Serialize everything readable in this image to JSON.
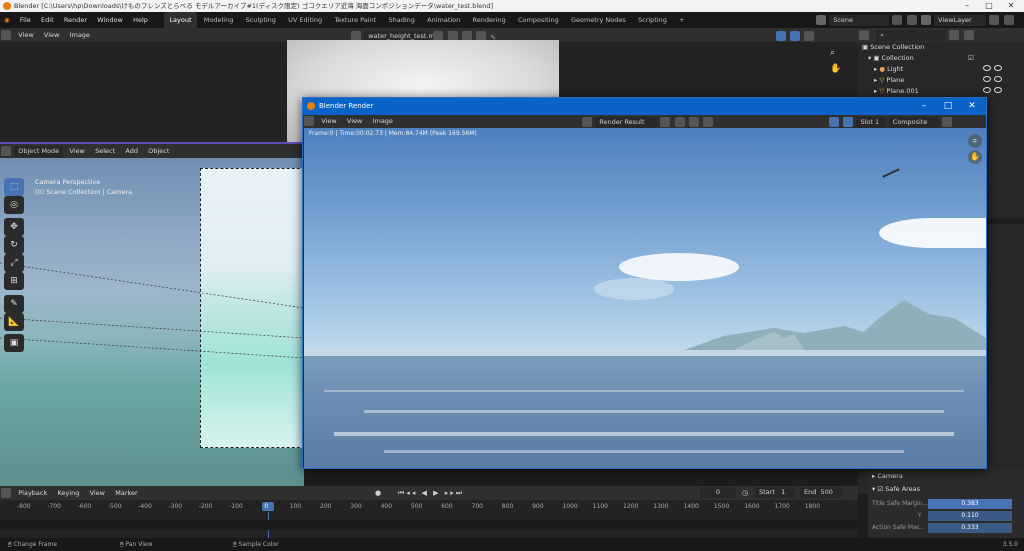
{
  "window": {
    "title": "Blender [C:\\Users\\hp\\Downloads\\けものフレンズとらべる モデルアーカイブ#1(ディスク限定) ゴコクエリア近海 海面コンポジションデータ\\water_test.blend]"
  },
  "menu": [
    "File",
    "Edit",
    "Render",
    "Window",
    "Help"
  ],
  "workspaces": [
    {
      "label": "Layout",
      "active": true
    },
    {
      "label": "Modeling"
    },
    {
      "label": "Sculpting"
    },
    {
      "label": "UV Editing"
    },
    {
      "label": "Texture Paint"
    },
    {
      "label": "Shading"
    },
    {
      "label": "Animation"
    },
    {
      "label": "Rendering"
    },
    {
      "label": "Compositing"
    },
    {
      "label": "Geometry Nodes"
    },
    {
      "label": "Scripting"
    },
    {
      "label": "+"
    }
  ],
  "scene": {
    "name": "Scene",
    "view_layer": "ViewLayer"
  },
  "image_editor": {
    "view": "View",
    "view2": "View",
    "image": "Image",
    "file": "water_height_test.mkv"
  },
  "viewport": {
    "mode": "Object Mode",
    "menus": [
      "View",
      "Select",
      "Add",
      "Object"
    ],
    "overlay_line1": "Camera Perspective",
    "overlay_line2": "(0) Scene Collection | Camera"
  },
  "outliner": {
    "root": "Scene Collection",
    "collection": "Collection",
    "items": [
      "Light",
      "Plane",
      "Plane.001"
    ]
  },
  "render_window": {
    "title": "Blender Render",
    "menus": [
      "View",
      "View",
      "Image"
    ],
    "result": "Render Result",
    "slot": "Slot 1",
    "pass": "Composite",
    "info": "Frame:0 | Time:00:02.73 | Mem:84.74M (Peak 169.56M)"
  },
  "properties": {
    "camera": "Camera",
    "safe_areas": "Safe Areas",
    "rows": [
      {
        "label": "Title Safe Margin...",
        "value": "0.383"
      },
      {
        "label": "Y",
        "value": "0.110"
      },
      {
        "label": "Action Safe Mar...",
        "value": "0.333"
      }
    ]
  },
  "timeline": {
    "menus": [
      "Playback",
      "Keying",
      "View",
      "Marker"
    ],
    "current_frame": "0",
    "start_label": "Start",
    "start": "1",
    "end_label": "End",
    "end": "500",
    "ticks": [
      "-800",
      "-700",
      "-600",
      "-500",
      "-400",
      "-300",
      "-200",
      "-100",
      "0",
      "100",
      "200",
      "300",
      "400",
      "500",
      "600",
      "700",
      "800",
      "900",
      "1000",
      "1100",
      "1200",
      "1300",
      "1400",
      "1500",
      "1600",
      "1700",
      "1800"
    ]
  },
  "status": {
    "left": "Change Frame",
    "middle": "Pan View",
    "right": "Sample Color",
    "version": "3.5.0"
  },
  "colors": {
    "accent": "#0a64c8",
    "active_frame": "#4772b3",
    "blender_orange": "#e87d0d"
  }
}
